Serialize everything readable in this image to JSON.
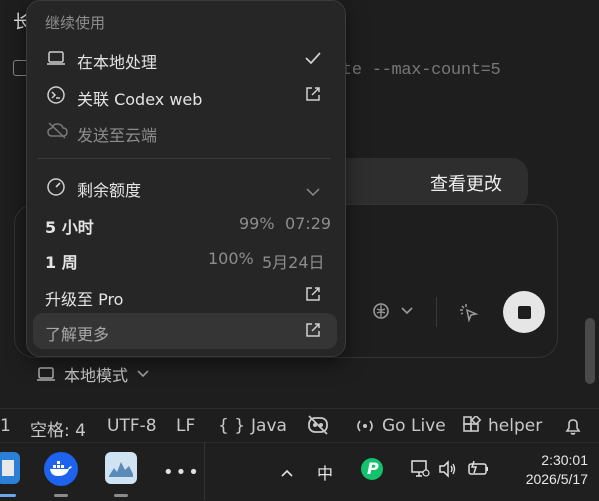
{
  "background": {
    "title": "长",
    "command": "te --max-count=5",
    "view_changes": "查看更改",
    "local_mode_label": "本地模式"
  },
  "menu": {
    "section_header": "继续使用",
    "items": [
      {
        "label": "在本地处理",
        "icon": "laptop-icon",
        "checked": true
      },
      {
        "label": "关联 Codex web",
        "icon": "codex-terminal-icon",
        "trailing": "external-link-icon"
      },
      {
        "label": "发送至云端",
        "icon": "cloud-off-icon",
        "disabled": true
      }
    ],
    "usage": {
      "label": "剩余额度",
      "icon": "gauge-icon",
      "rows": [
        {
          "label": "5 小时",
          "percent": "99%",
          "reset": "07:29"
        },
        {
          "label": "1 周",
          "percent": "100%",
          "reset": "5月24日"
        }
      ]
    },
    "upgrade": "升级至 Pro",
    "learn_more": "了解更多"
  },
  "statusbar": {
    "line": "1",
    "spaces": "空格: 4",
    "encoding": "UTF-8",
    "eol": "LF",
    "language": "Java",
    "go_live": "Go Live",
    "branch": "helper"
  },
  "taskbar": {
    "ime": "中",
    "time": "2:30:01",
    "date": "2026/5/17"
  },
  "colors": {
    "popup_bg": "#262626",
    "muted": "#8d8d8d",
    "accent_green": "#13c26d"
  }
}
